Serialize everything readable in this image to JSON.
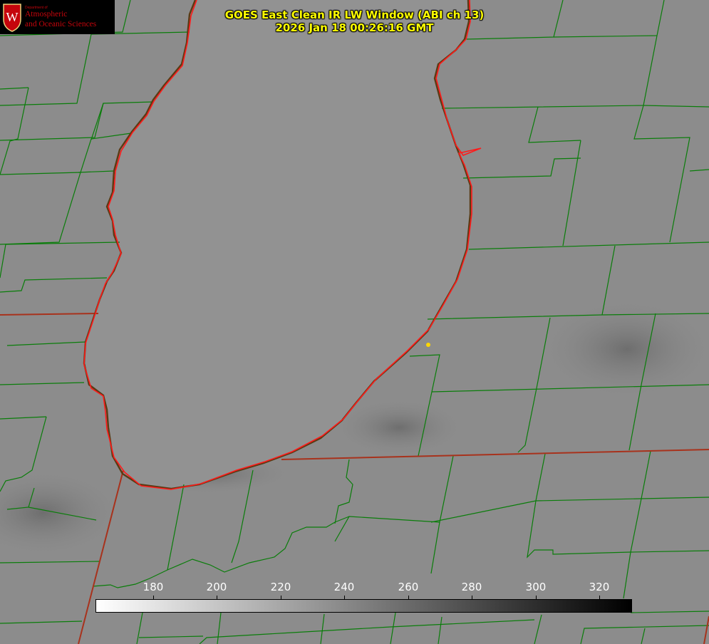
{
  "header": {
    "title_line1": "GOES East Clean IR LW Window (ABI ch 13)",
    "title_line2": "2026 Jan 18 00:26:16 GMT"
  },
  "logo": {
    "dept": "Department of",
    "line1": "Atmospheric",
    "line2": "and Oceanic Sciences",
    "seal_letter": "W"
  },
  "colorbar": {
    "labels": [
      "180",
      "200",
      "220",
      "240",
      "260",
      "280",
      "300",
      "320"
    ],
    "gradient": "white-to-black"
  },
  "colors": {
    "title": "#ffff00",
    "county_lines": "#008000",
    "state_lines": "#c0392b",
    "lake_outline": "#ff0000",
    "marker": "#ffd700",
    "background": "#8a8a8a"
  }
}
